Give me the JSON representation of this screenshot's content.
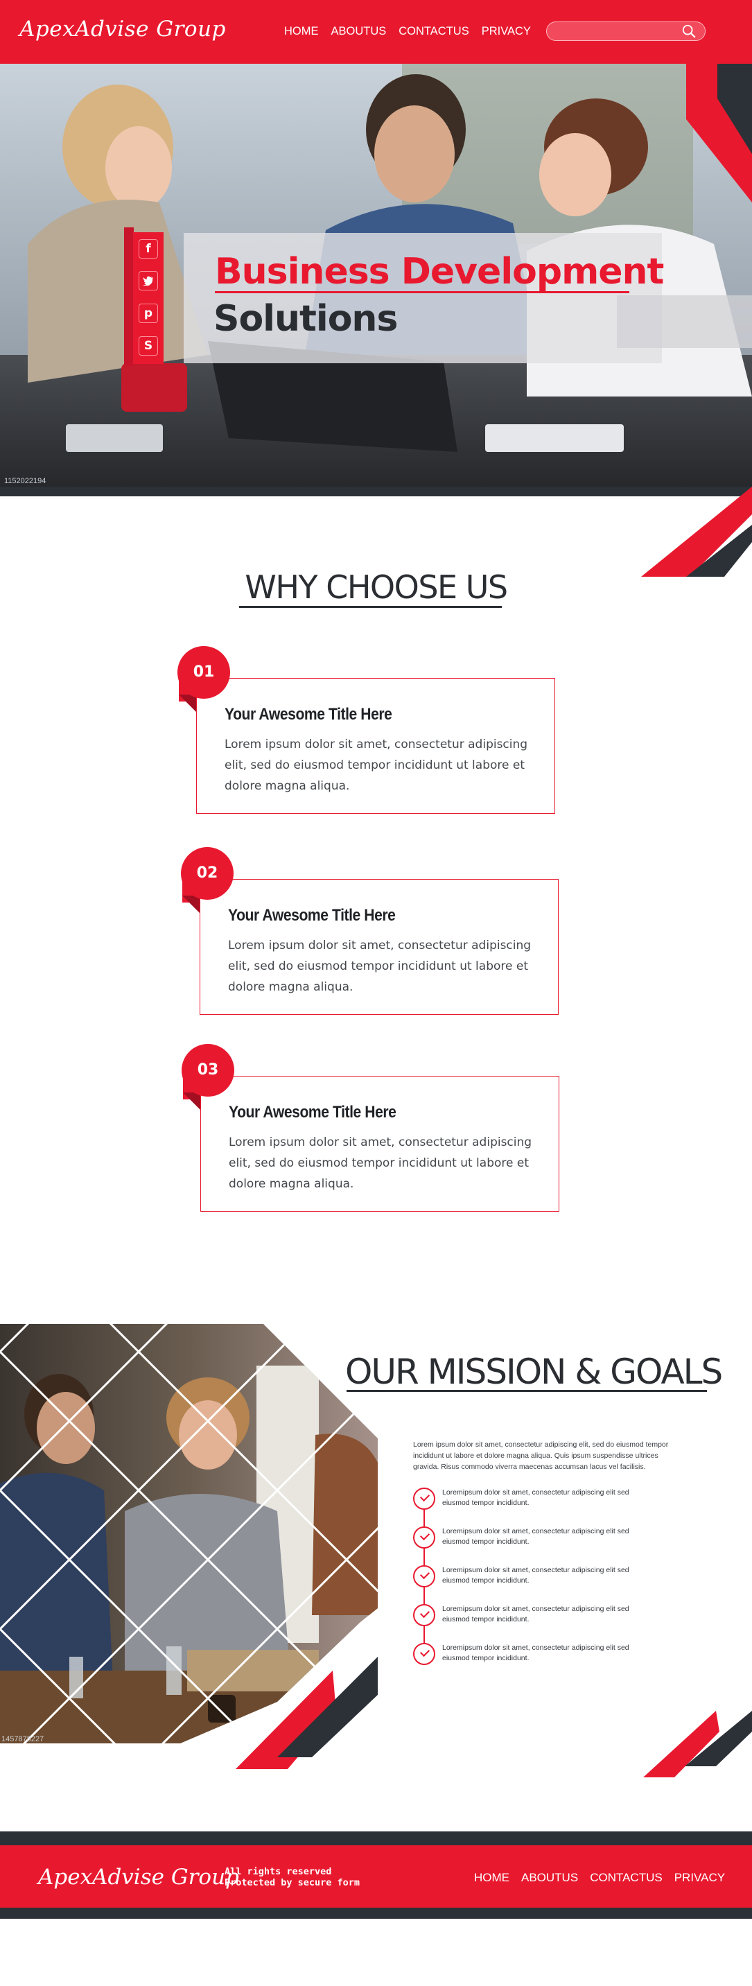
{
  "header": {
    "logo": "ApexAdvise Group",
    "nav": [
      "HOME",
      "ABOUTUS",
      "CONTACTUS",
      "PRIVACY"
    ],
    "search_placeholder": "",
    "search_icon": "search-icon"
  },
  "hero": {
    "title_line1": "Business Development",
    "title_line2": "Solutions",
    "image_id": "1152022194",
    "social_icons": [
      {
        "name": "facebook-icon",
        "glyph": "f"
      },
      {
        "name": "twitter-icon",
        "glyph": "t"
      },
      {
        "name": "pinterest-icon",
        "glyph": "p"
      },
      {
        "name": "skype-icon",
        "glyph": "S"
      }
    ]
  },
  "why": {
    "title": "WHY CHOOSE US",
    "cards": [
      {
        "number": "01",
        "title": "Your Awesome Title Here",
        "text": "Lorem ipsum dolor sit amet, consectetur adipiscing elit, sed do eiusmod tempor incididunt ut labore et dolore magna aliqua."
      },
      {
        "number": "02",
        "title": "Your Awesome Title Here",
        "text": "Lorem ipsum dolor sit amet, consectetur adipiscing elit, sed do eiusmod tempor incididunt ut labore et dolore magna aliqua."
      },
      {
        "number": "03",
        "title": "Your Awesome Title Here",
        "text": "Lorem ipsum dolor sit amet, consectetur adipiscing elit, sed do eiusmod tempor incididunt ut labore et dolore magna aliqua."
      }
    ]
  },
  "mission": {
    "title": "OUR MISSION & GOALS",
    "image_id": "1457878227",
    "intro": "Lorem ipsum dolor sit amet, consectetur adipiscing elit, sed do eiusmod tempor incididunt ut labore et dolore magna aliqua. Quis ipsum suspendisse ultrices gravida. Risus commodo viverra maecenas accumsan lacus vel facilisis.",
    "goals": [
      "Loremipsum dolor sit amet, consectetur adipiscing elit sed eiusmod tempor incididunt.",
      "Loremipsum dolor sit amet, consectetur adipiscing elit sed eiusmod tempor incididunt.",
      "Loremipsum dolor sit amet, consectetur adipiscing elit sed eiusmod tempor incididunt.",
      "Loremipsum dolor sit amet, consectetur adipiscing elit sed eiusmod tempor incididunt.",
      "Loremipsum dolor sit amet, consectetur adipiscing elit sed eiusmod tempor incididunt."
    ]
  },
  "footer": {
    "logo": "ApexAdvise Group",
    "legal_line1": "All rights reserved",
    "legal_line2": "Protected by secure form",
    "nav": [
      "HOME",
      "ABOUTUS",
      "CONTACTUS",
      "PRIVACY"
    ]
  },
  "colors": {
    "accent": "#e8192f",
    "dark": "#2b3137"
  }
}
